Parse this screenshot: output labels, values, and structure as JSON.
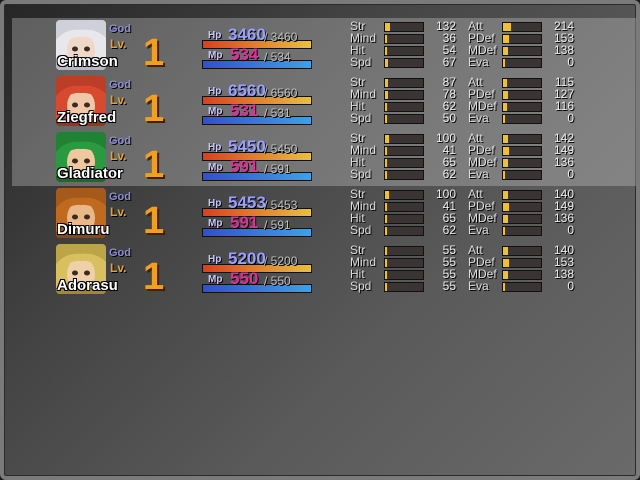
{
  "party": [
    {
      "name": "Crimson",
      "class": "God",
      "lv_label": "Lv.",
      "level": "1",
      "hp_label": "Hp",
      "hp": "3460",
      "hp_max": "/ 3460",
      "mp_label": "Mp",
      "mp": "534",
      "mp_max": "/ 534",
      "str": "132",
      "mind": "36",
      "hit": "54",
      "spd": "67",
      "att": "214",
      "pdef": "153",
      "mdef": "138",
      "eva": "0",
      "hair": "#e8e8ec",
      "skin": "#f0d8c8",
      "accent": "#b8b8c8"
    },
    {
      "name": "Ziegfred",
      "class": "God",
      "lv_label": "Lv.",
      "level": "1",
      "hp_label": "Hp",
      "hp": "6560",
      "hp_max": "/ 6560",
      "mp_label": "Mp",
      "mp": "531",
      "mp_max": "/ 531",
      "str": "87",
      "mind": "78",
      "hit": "62",
      "spd": "50",
      "att": "115",
      "pdef": "127",
      "mdef": "116",
      "eva": "0",
      "hair": "#d84a30",
      "skin": "#f0c8a8",
      "accent": "#a03020"
    },
    {
      "name": "Gladiator",
      "class": "God",
      "lv_label": "Lv.",
      "level": "1",
      "hp_label": "Hp",
      "hp": "5450",
      "hp_max": "/ 5450",
      "mp_label": "Mp",
      "mp": "591",
      "mp_max": "/ 591",
      "str": "100",
      "mind": "41",
      "hit": "65",
      "spd": "62",
      "att": "142",
      "pdef": "149",
      "mdef": "136",
      "eva": "0",
      "hair": "#2a9a40",
      "skin": "#f0c8a0",
      "accent": "#1a6a28"
    },
    {
      "name": "Dimuru",
      "class": "God",
      "lv_label": "Lv.",
      "level": "1",
      "hp_label": "Hp",
      "hp": "5453",
      "hp_max": "/ 5453",
      "mp_label": "Mp",
      "mp": "591",
      "mp_max": "/ 591",
      "str": "100",
      "mind": "41",
      "hit": "65",
      "spd": "62",
      "att": "140",
      "pdef": "149",
      "mdef": "136",
      "eva": "0",
      "hair": "#c06a20",
      "skin": "#e8b888",
      "accent": "#8a4a18"
    },
    {
      "name": "Adorasu",
      "class": "God",
      "lv_label": "Lv.",
      "level": "1",
      "hp_label": "Hp",
      "hp": "5200",
      "hp_max": "/ 5200",
      "mp_label": "Mp",
      "mp": "550",
      "mp_max": "/ 550",
      "str": "55",
      "mind": "55",
      "hit": "55",
      "spd": "55",
      "att": "140",
      "pdef": "153",
      "mdef": "138",
      "eva": "0",
      "hair": "#d8c060",
      "skin": "#f0d0a8",
      "accent": "#a08a30"
    }
  ],
  "stat_labels": {
    "str": "Str",
    "mind": "Mind",
    "hit": "Hit",
    "spd": "Spd",
    "att": "Att",
    "pdef": "PDef",
    "mdef": "MDef",
    "eva": "Eva"
  },
  "selected_rows": [
    0,
    1,
    2
  ],
  "colors": {
    "level": "#f0a020",
    "class": "#8c8cd8",
    "hp_value": "#9aa0ff",
    "mp_value": "#e0309a",
    "stat_fill": "#f0c030"
  }
}
